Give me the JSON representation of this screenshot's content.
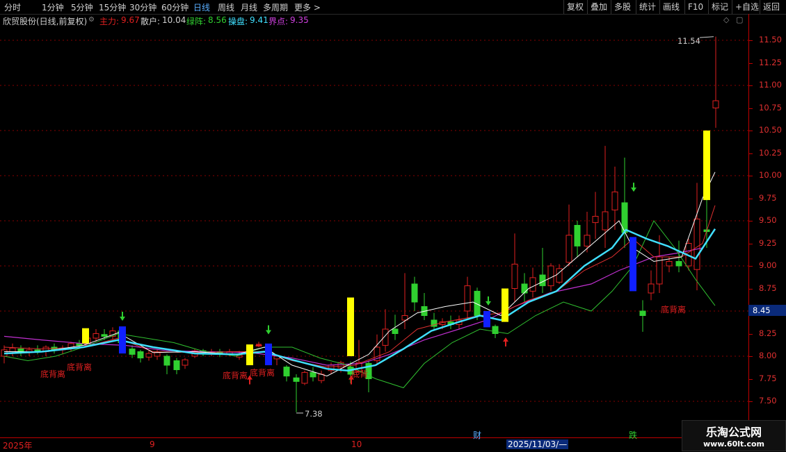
{
  "tabs": [
    "分时",
    "1分钟",
    "5分钟",
    "15分钟",
    "30分钟",
    "60分钟",
    "日线",
    "周线",
    "月线",
    "多周期",
    "更多 >"
  ],
  "active_tab": "日线",
  "right_buttons": [
    "复权",
    "叠加",
    "多股",
    "统计",
    "画线",
    "F10",
    "标记",
    "+自选",
    "返回"
  ],
  "info": {
    "stock": "欣贸股份(日线,前复权)",
    "l1": "主力:",
    "v1": "9.67",
    "l2": "散户:",
    "v2": "10.04",
    "l3": "绿阵:",
    "v3": "8.56",
    "l4": "操盘:",
    "v4": "9.41",
    "l5": "界点:",
    "v5": "9.35"
  },
  "axis_ticks": [
    "11.50",
    "11.25",
    "11.00",
    "10.75",
    "10.50",
    "10.25",
    "10.00",
    "9.75",
    "9.50",
    "9.25",
    "9.00",
    "8.75",
    "8.50",
    "8.25",
    "8.00",
    "7.75",
    "7.50"
  ],
  "current_price": "8.45",
  "annotations": {
    "high": "11.54",
    "low": "7.38",
    "divergence": "底背离",
    "divergence_partial": "底背"
  },
  "bottom": {
    "year": "2025年",
    "m9": "9",
    "m10": "10",
    "cai": "财",
    "date": "2025/11/03/—",
    "die": "跌"
  },
  "watermark": {
    "name": "乐淘公式网",
    "url": "www.60lt.com"
  },
  "colors": {
    "up": "#e02020",
    "down": "#30d030",
    "white_line": "#ffffff",
    "cyan_line": "#40e0ff",
    "magenta_line": "#c030d0",
    "green_line": "#30c030",
    "red_line": "#e03030",
    "yellow_bar": "#ffff00",
    "blue_bar": "#1020ff"
  }
}
